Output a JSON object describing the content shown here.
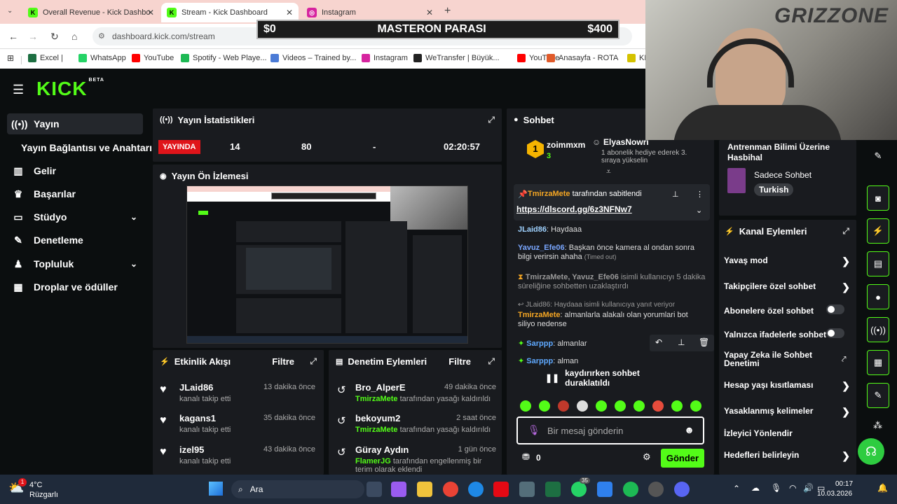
{
  "browser": {
    "tabs": [
      {
        "label": "Overall Revenue - Kick Dashbo",
        "fav": "K",
        "color": "#53fc18"
      },
      {
        "label": "Stream - Kick Dashboard",
        "fav": "K",
        "color": "#53fc18"
      },
      {
        "label": "Instagram",
        "fav": "◎",
        "color": "#d6249f"
      }
    ],
    "url": "dashboard.kick.com/stream",
    "bookmarks": [
      {
        "label": "Excel |",
        "color": "#1d6f42"
      },
      {
        "label": "WhatsApp",
        "color": "#25d366"
      },
      {
        "label": "YouTube",
        "color": "#ff0000"
      },
      {
        "label": "Spotify - Web Playe...",
        "color": "#1db954"
      },
      {
        "label": "Videos – Trained by...",
        "color": "#4b7bd6"
      },
      {
        "label": "Instagram",
        "color": "#d6249f"
      },
      {
        "label": "WeTransfer | Büyük...",
        "color": "#222"
      },
      {
        "label": "YouTube",
        "color": "#ff0000"
      },
      {
        "label": "Anasayfa - ROTA",
        "color": "#e05a2a"
      },
      {
        "label": "KE",
        "color": "#d4c200"
      }
    ]
  },
  "overlay": {
    "left": "$0",
    "title": "MASTERON PARASI",
    "right": "$400"
  },
  "webcam": {
    "watermark": "GRIZZONE"
  },
  "sidebar": {
    "logo": "KICK",
    "logo_badge": "BETA",
    "items": [
      {
        "label": "Yayın",
        "icon": "broadcast-icon"
      },
      {
        "label": "Yayın Bağlantısı ve Anahtarı",
        "icon": ""
      },
      {
        "label": "Gelir",
        "icon": "chart-icon"
      },
      {
        "label": "Başarılar",
        "icon": "trophy-icon"
      },
      {
        "label": "Stüdyo",
        "icon": "studio-icon"
      },
      {
        "label": "Denetleme",
        "icon": "wrench-icon"
      },
      {
        "label": "Topluluk",
        "icon": "community-icon"
      },
      {
        "label": "Droplar ve ödüller",
        "icon": "gift-icon"
      }
    ]
  },
  "stats": {
    "title": "Yayın İstatistikleri",
    "live": "YAYINDA",
    "viewers": "14",
    "followers": "80",
    "dash": "-",
    "uptime": "02:20:57"
  },
  "preview": {
    "title": "Yayın Ön İzlemesi"
  },
  "activity": {
    "title": "Etkinlik Akışı",
    "filter": "Filtre",
    "items": [
      {
        "name": "JLaid86",
        "sub": "kanalı takip etti",
        "time": "13 dakika önce"
      },
      {
        "name": "kagans1",
        "sub": "kanalı takip etti",
        "time": "35 dakika önce"
      },
      {
        "name": "izel95",
        "sub": "kanalı takip etti",
        "time": "43 dakika önce"
      }
    ]
  },
  "moderation": {
    "title": "Denetim Eylemleri",
    "filter": "Filtre",
    "items": [
      {
        "name": "Bro_AlperE",
        "by": "TmirzaMete",
        "sub": "tarafından yasağı kaldırıldı",
        "time": "49 dakika önce"
      },
      {
        "name": "bekoyum2",
        "by": "TmirzaMete",
        "sub": "tarafından yasağı kaldırıldı",
        "time": "2 saat önce"
      },
      {
        "name": "Güray Aydın",
        "by": "FlamerJG",
        "sub": "tarafından engellenmiş bir terim olarak eklendi",
        "time": "1 gün önce"
      }
    ]
  },
  "chat": {
    "title": "Sohbet",
    "top_gifter": "zoimmxm",
    "top_gifter_count": "3",
    "gift_user": "ElyasNowrı",
    "gift_text": "1 abonelik hediye ederek 3. sıraya yükselin",
    "pinned_by": "TmirzaMete",
    "pinned_suffix": "tarafından sabitlendi",
    "pinned_link": "https://dlscord.gg/6z3NFNw7",
    "messages": [
      {
        "user": "JLaid86",
        "color": "#9fd2ff",
        "text": "Haydaaa"
      },
      {
        "user": "Yavuz_Efe06",
        "color": "#7aa7ff",
        "text": "Başkan önce kamera al ondan sonra bilgi verirsin ahaha",
        "tag": "(Timed out)"
      },
      {
        "user": "TmirzaMete, Yavuz_Efe06",
        "color": "#aaa",
        "text": "isimli kullanıcıyı 5 dakika süreliğine sohbetten uzaklaştırdı"
      },
      {
        "user": "JLaid86: Haydaaa isimli kullanıcıya yanıt veriyor",
        "color": "#888",
        "text": ""
      },
      {
        "user": "TmirzaMete",
        "color": "#f5a623",
        "text": "almanlarla alakalı olan yorumlari bot siliyo nedense"
      },
      {
        "user": "Sarppp",
        "color": "#5fa9ff",
        "text": "almanlar"
      },
      {
        "user": "Sarppp",
        "color": "#5fa9ff",
        "text": "alman"
      }
    ],
    "paused": "kaydırırken sohbet duraklatıldı",
    "placeholder": "Bir mesaj gönderin",
    "points": "0",
    "send": "Gönder"
  },
  "right": {
    "stream_title": "Antrenman Bilimi Üzerine Hasbihal",
    "category": "Sadece Sohbet",
    "tag": "Turkish",
    "actions_title": "Kanal Eylemleri",
    "actions": [
      {
        "label": "Yavaş mod",
        "type": "arrow"
      },
      {
        "label": "Takipçilere özel sohbet",
        "type": "arrow"
      },
      {
        "label": "Abonelere özel sohbet",
        "type": "toggle"
      },
      {
        "label": "Yalnızca ifadelerle sohbet",
        "type": "toggle"
      },
      {
        "label": "Yapay Zeka ile Sohbet Denetimi",
        "type": "link"
      },
      {
        "label": "Hesap yaşı kısıtlaması",
        "type": "arrow"
      },
      {
        "label": "Yasaklanmış kelimeler",
        "type": "arrow"
      },
      {
        "label": "İzleyici Yönlendir",
        "type": "none"
      },
      {
        "label": "Hedefleri belirleyin",
        "type": "arrow"
      }
    ]
  },
  "taskbar": {
    "weather_temp": "4°C",
    "weather_desc": "Rüzgarlı",
    "search": "Ara",
    "time": "00:17",
    "date": "10.03.2026",
    "badge": "35"
  }
}
